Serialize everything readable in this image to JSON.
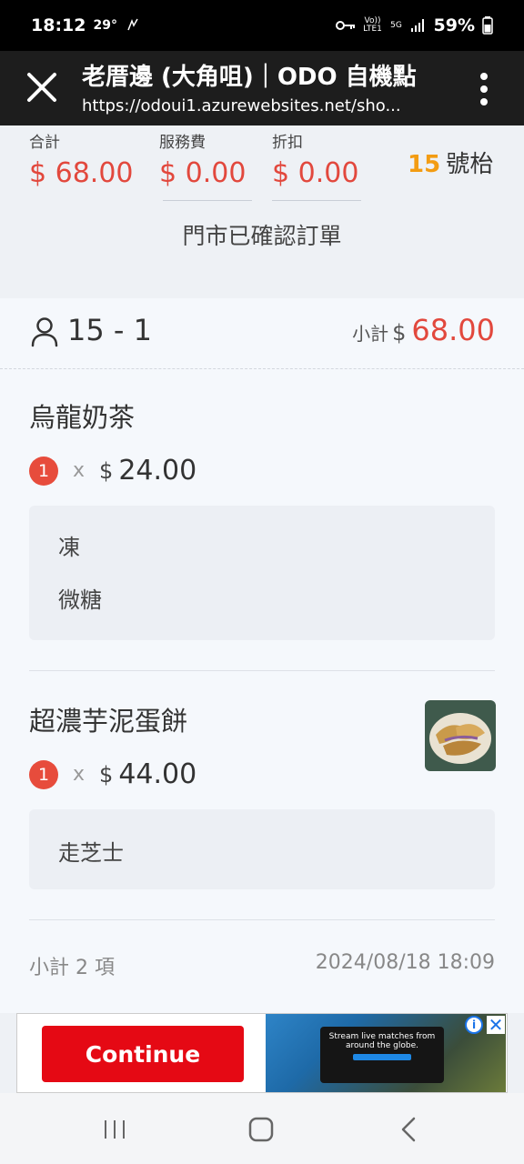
{
  "status_bar": {
    "time": "18:12",
    "temp": "29°",
    "network": "5G",
    "volte": "Vo)) LTE1",
    "battery": "59%"
  },
  "appbar": {
    "title": "老厝邊 (大角咀)｜ODO 自機點",
    "url": "https://odoui1.azurewebsites.net/sho..."
  },
  "summary": {
    "total_label": "合計",
    "total_value": "$ 68.00",
    "service_label": "服務費",
    "service_value": "$ 0.00",
    "discount_label": "折扣",
    "discount_value": "$ 0.00",
    "table_number": "15",
    "table_suffix": "號枱",
    "confirmed_text": "門市已確認訂單"
  },
  "order": {
    "guest": "15 - 1",
    "subtotal_label": "小計",
    "subtotal_currency": "$",
    "subtotal_value": "68.00",
    "items": [
      {
        "name": "烏龍奶茶",
        "qty": "1",
        "times": "x",
        "currency": "$",
        "price": "24.00",
        "options": [
          "凍",
          "微糖"
        ]
      },
      {
        "name": "超濃芋泥蛋餅",
        "qty": "1",
        "times": "x",
        "currency": "$",
        "price": "44.00",
        "options": [
          "走芝士"
        ]
      }
    ],
    "item_count": "小計 2 項",
    "datetime": "2024/08/18 18:09"
  },
  "ad": {
    "cta": "Continue",
    "headline": "Stream live matches from around the globe."
  },
  "colors": {
    "accent_red": "#e2483d",
    "table_orange": "#f39c12",
    "ad_red": "#e50914"
  }
}
